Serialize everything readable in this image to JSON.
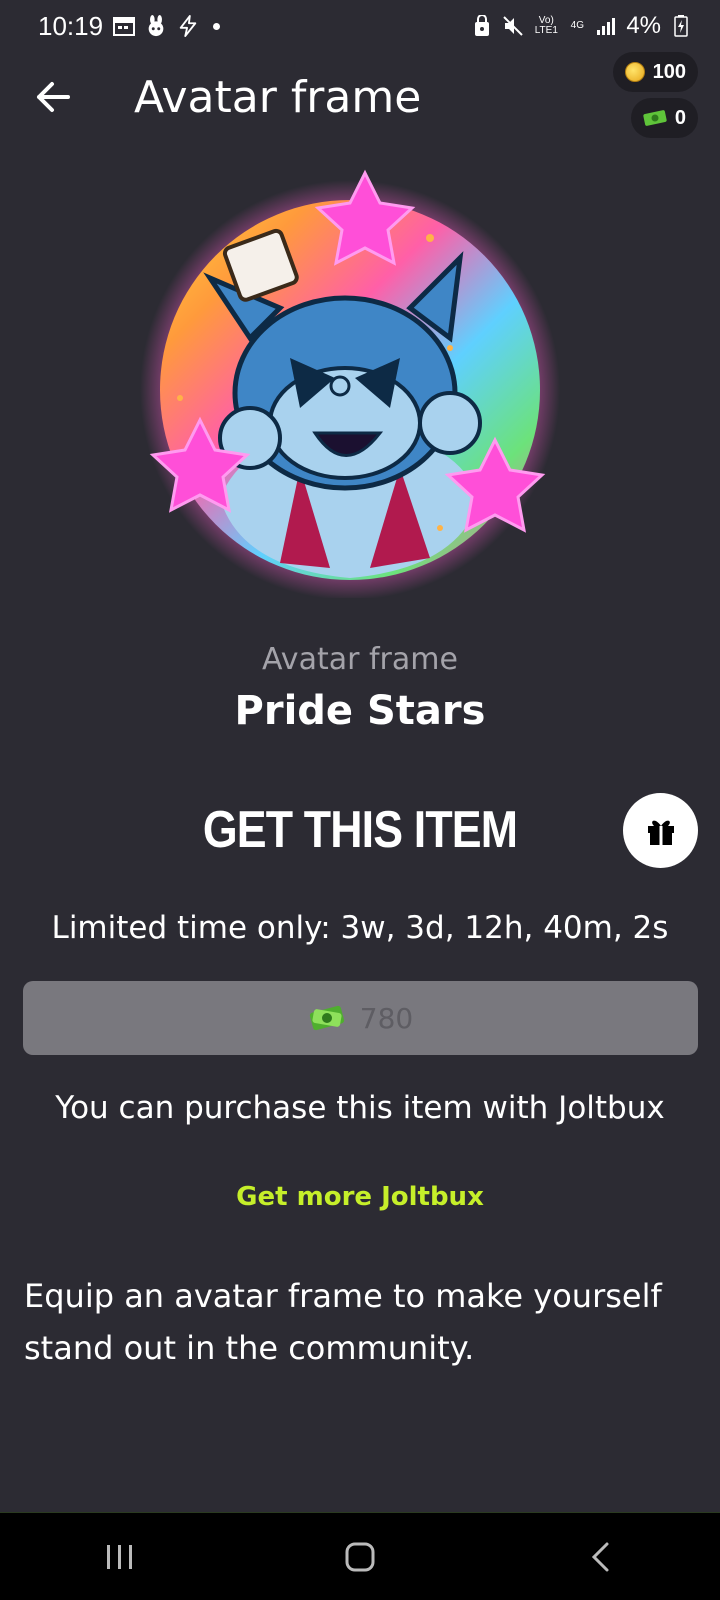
{
  "status_bar": {
    "time": "10:19",
    "battery": "4%",
    "network": "4G",
    "volte": "Vo) LTE1"
  },
  "header": {
    "title": "Avatar frame",
    "back_icon": "arrow-left-icon"
  },
  "wallet": {
    "coins": "100",
    "joltbux": "0"
  },
  "item": {
    "type_label": "Avatar frame",
    "name": "Pride Stars"
  },
  "get_item_label": "GET THIS ITEM",
  "gift_icon": "gift-icon",
  "limited_time": "Limited time only: 3w, 3d, 12h, 40m, 2s",
  "buy": {
    "price": "780",
    "currency_icon": "joltbux-icon"
  },
  "purchase_note": "You can purchase this item with Joltbux",
  "get_more_link": "Get more Joltbux",
  "description": "Equip an avatar frame to make yourself stand out in the community.",
  "colors": {
    "background": "#2c2b33",
    "accent": "#c6ef2a",
    "button_disabled": "#79787e"
  }
}
